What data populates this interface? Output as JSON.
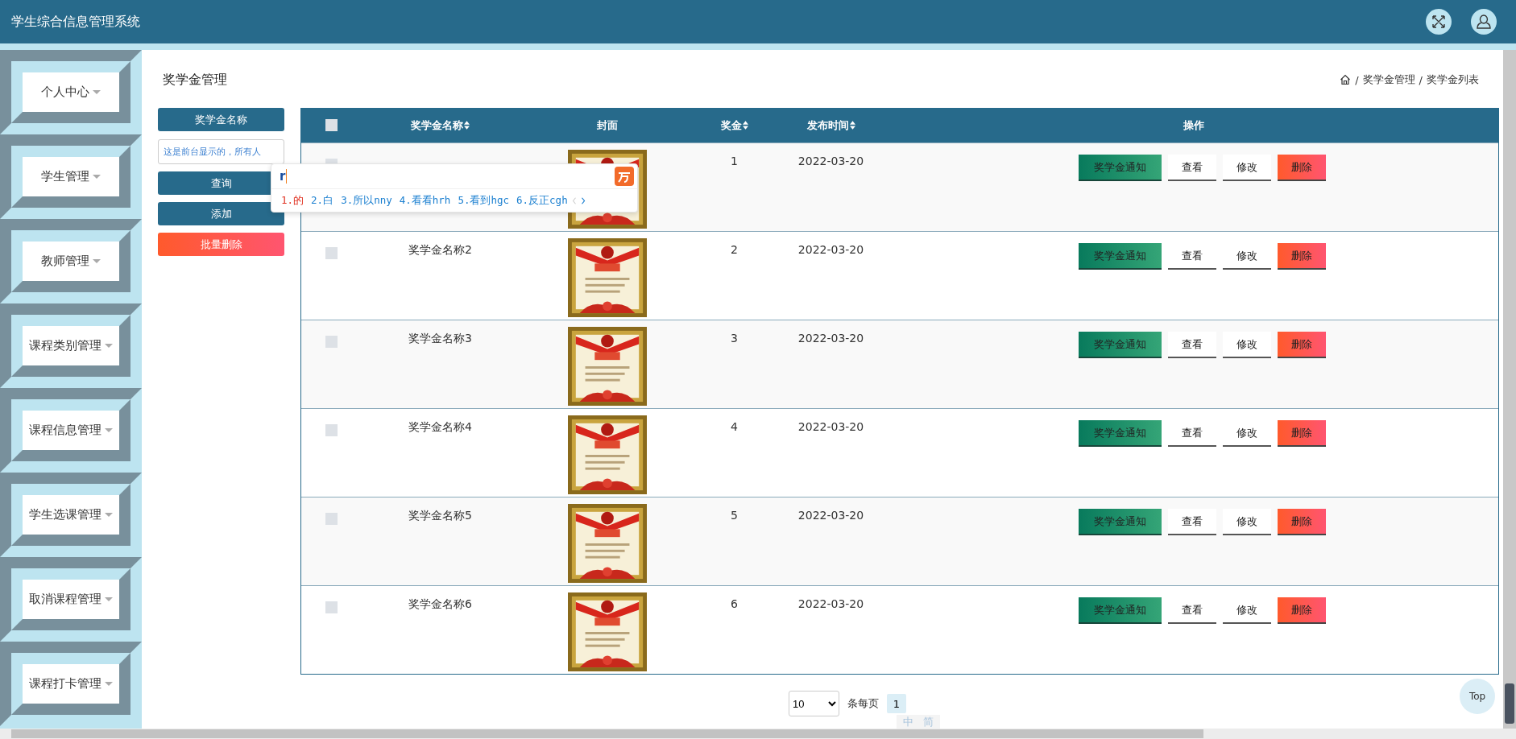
{
  "header": {
    "title": "学生综合信息管理系统"
  },
  "sidebar": {
    "items": [
      {
        "label": "个人中心"
      },
      {
        "label": "学生管理"
      },
      {
        "label": "教师管理"
      },
      {
        "label": "课程类别管理"
      },
      {
        "label": "课程信息管理"
      },
      {
        "label": "学生选课管理"
      },
      {
        "label": "取消课程管理"
      },
      {
        "label": "课程打卡管理"
      }
    ]
  },
  "page": {
    "title": "奖学金管理",
    "separator": "/",
    "breadcrumb": [
      "奖学金管理",
      "奖学金列表"
    ]
  },
  "search": {
    "label": "奖学金名称",
    "value": "这是前台显示的，所有人",
    "buttons": [
      {
        "label": "查询",
        "kind": "primary"
      },
      {
        "label": "添加",
        "kind": "primary"
      },
      {
        "label": "批量删除",
        "kind": "danger"
      }
    ]
  },
  "table": {
    "select_all": {
      "checked": false
    },
    "columns": [
      {
        "label": "奖学金名称",
        "sortable": true
      },
      {
        "label": "封面",
        "sortable": false
      },
      {
        "label": "奖金",
        "sortable": true
      },
      {
        "label": "发布时间",
        "sortable": true
      },
      {
        "label": "操作",
        "sortable": false
      }
    ],
    "rows": [
      {
        "checked": false,
        "amount": "1",
        "date": "2022-03-20",
        "cover": {
          "kind": "picture"
        },
        "actions": [
          {
            "label": "奖学金通知",
            "kind": "notify"
          },
          {
            "label": "查看",
            "kind": "plain"
          },
          {
            "label": "修改",
            "kind": "plain"
          },
          {
            "label": "删除",
            "kind": "danger"
          }
        ]
      },
      {
        "checked": false,
        "name": "奖学金名称2",
        "amount": "2",
        "date": "2022-03-20",
        "cover": {
          "kind": "picture"
        },
        "actions": [
          {
            "label": "奖学金通知",
            "kind": "notify"
          },
          {
            "label": "查看",
            "kind": "plain"
          },
          {
            "label": "修改",
            "kind": "plain"
          },
          {
            "label": "删除",
            "kind": "danger"
          }
        ]
      },
      {
        "checked": false,
        "name": "奖学金名称3",
        "amount": "3",
        "date": "2022-03-20",
        "cover": {
          "kind": "picture"
        },
        "actions": [
          {
            "label": "奖学金通知",
            "kind": "notify"
          },
          {
            "label": "查看",
            "kind": "plain"
          },
          {
            "label": "修改",
            "kind": "plain"
          },
          {
            "label": "删除",
            "kind": "danger"
          }
        ]
      },
      {
        "checked": false,
        "name": "奖学金名称4",
        "amount": "4",
        "date": "2022-03-20",
        "cover": {
          "kind": "picture"
        },
        "actions": [
          {
            "label": "奖学金通知",
            "kind": "notify"
          },
          {
            "label": "查看",
            "kind": "plain"
          },
          {
            "label": "修改",
            "kind": "plain"
          },
          {
            "label": "删除",
            "kind": "danger"
          }
        ]
      },
      {
        "checked": false,
        "name": "奖学金名称5",
        "amount": "5",
        "date": "2022-03-20",
        "cover": {
          "kind": "picture"
        },
        "actions": [
          {
            "label": "奖学金通知",
            "kind": "notify"
          },
          {
            "label": "查看",
            "kind": "plain"
          },
          {
            "label": "修改",
            "kind": "plain"
          },
          {
            "label": "删除",
            "kind": "danger"
          }
        ]
      },
      {
        "checked": false,
        "name": "奖学金名称6",
        "amount": "6",
        "date": "2022-03-20",
        "cover": {
          "kind": "picture"
        },
        "actions": [
          {
            "label": "奖学金通知",
            "kind": "notify"
          },
          {
            "label": "查看",
            "kind": "plain"
          },
          {
            "label": "修改",
            "kind": "plain"
          },
          {
            "label": "删除",
            "kind": "danger"
          }
        ]
      }
    ]
  },
  "pagination": {
    "page_size": "10",
    "size_label": "条每页",
    "pages": [
      {
        "label": "1",
        "selected": true
      }
    ]
  },
  "top_button": {
    "label": "Top"
  },
  "ime": {
    "composition": "r",
    "candidates": [
      {
        "label": "1.的",
        "selected": true
      },
      {
        "label": "2.白",
        "selected": false
      },
      {
        "label": "3.所以nny",
        "selected": false
      },
      {
        "label": "4.看看hrh",
        "selected": false
      },
      {
        "label": "5.看到hgc",
        "selected": false
      },
      {
        "label": "6.反正cgh",
        "selected": false
      }
    ],
    "toolbar": [
      "中",
      "简"
    ]
  }
}
